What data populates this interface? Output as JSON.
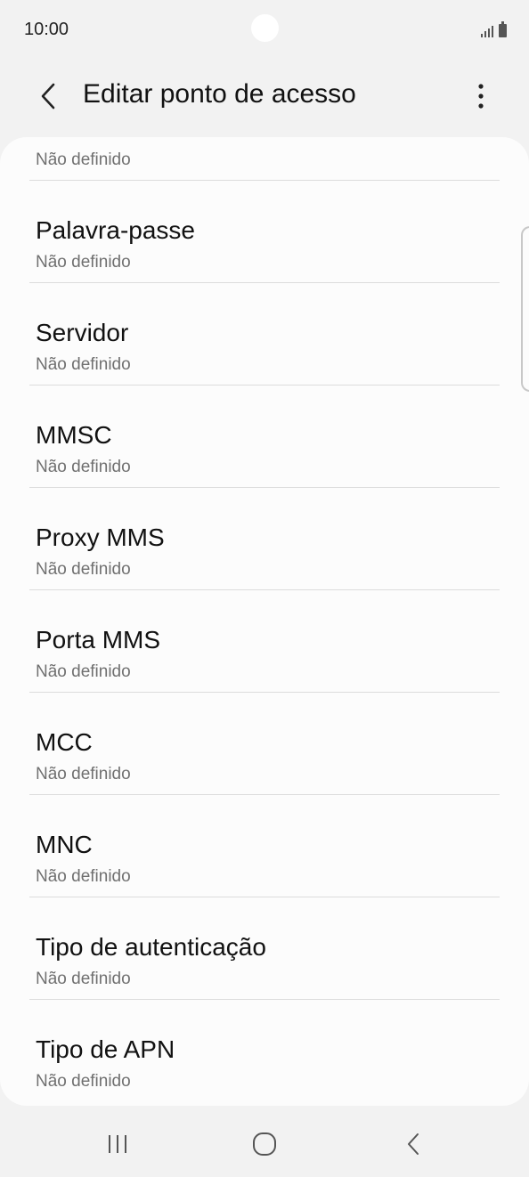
{
  "status_bar": {
    "time": "10:00",
    "signal_icon": "signal-icon",
    "battery_icon": "battery-icon"
  },
  "header": {
    "title": "Editar ponto de acesso",
    "back_icon": "back-arrow-icon",
    "more_icon": "more-options-icon"
  },
  "items": [
    {
      "label": "",
      "value": "Não definido"
    },
    {
      "label": "Palavra-passe",
      "value": "Não definido"
    },
    {
      "label": "Servidor",
      "value": "Não definido"
    },
    {
      "label": "MMSC",
      "value": "Não definido"
    },
    {
      "label": "Proxy MMS",
      "value": "Não definido"
    },
    {
      "label": "Porta MMS",
      "value": "Não definido"
    },
    {
      "label": "MCC",
      "value": "Não definido"
    },
    {
      "label": "MNC",
      "value": "Não definido"
    },
    {
      "label": "Tipo de autenticação",
      "value": "Não definido"
    },
    {
      "label": "Tipo de APN",
      "value": "Não definido"
    }
  ],
  "nav_bar": {
    "recents_icon": "recents-icon",
    "home_icon": "home-icon",
    "back_icon": "nav-back-icon"
  }
}
